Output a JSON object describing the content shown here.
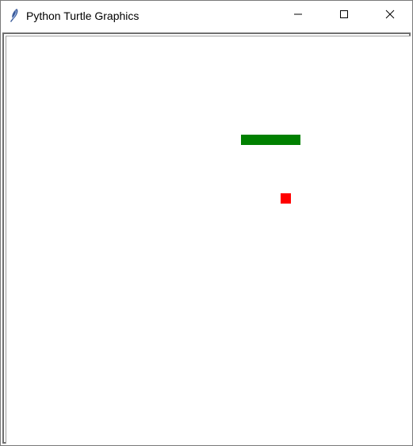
{
  "window": {
    "title": "Python Turtle Graphics",
    "icon": "feather-icon",
    "controls": {
      "minimize": "minimize-icon",
      "maximize": "maximize-icon",
      "close": "close-icon"
    }
  },
  "canvas": {
    "background": "#ffffff",
    "snake_color": "#008000",
    "food_color": "#ff0000"
  }
}
